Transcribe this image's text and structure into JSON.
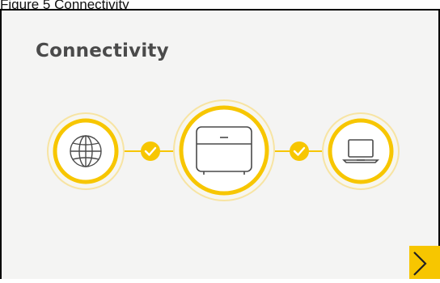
{
  "figure": {
    "caption": "Figure 5   Connectivity"
  },
  "card": {
    "title": "Connectivity",
    "accent_color": "#f7c600",
    "background_color": "#f4f4f3"
  },
  "nodes": [
    {
      "name": "internet",
      "icon": "globe-icon"
    },
    {
      "name": "device",
      "icon": "router-icon"
    },
    {
      "name": "computer",
      "icon": "laptop-icon"
    }
  ],
  "connectors": [
    {
      "status": "connected",
      "icon": "check-icon"
    },
    {
      "status": "connected",
      "icon": "check-icon"
    }
  ],
  "navigation": {
    "next_icon": "chevron-right-icon"
  }
}
